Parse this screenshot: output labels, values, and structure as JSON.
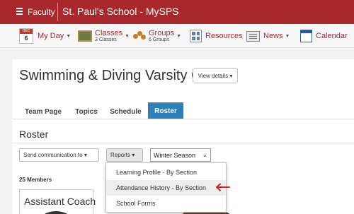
{
  "topbar": {
    "role": "Faculty",
    "school": "St. Paul's School - MySPS"
  },
  "nav": {
    "myday": {
      "label": "My Day",
      "cal_month": "DEC",
      "cal_day": "6"
    },
    "classes": {
      "label": "Classes",
      "count": "3 Classes"
    },
    "groups": {
      "label": "Groups",
      "count": "6 Groups"
    },
    "resources": {
      "label": "Resources"
    },
    "news": {
      "label": "News"
    },
    "calendar": {
      "label": "Calendar"
    }
  },
  "page": {
    "title": "Swimming & Diving Varsity Girls",
    "view_details": "View details ▾"
  },
  "tabs": [
    {
      "label": "Team Page"
    },
    {
      "label": "Topics"
    },
    {
      "label": "Schedule"
    },
    {
      "label": "Roster"
    }
  ],
  "roster": {
    "title": "Roster",
    "send_communication": "Send communication to ▾",
    "reports": "Reports ▾",
    "season": "Winter Season",
    "members": "25 Members",
    "card_title": "Assistant Coach"
  },
  "reports_menu": [
    {
      "label": "Learning Profile - By Section"
    },
    {
      "label": "Attendance History - By Section"
    },
    {
      "label": "School Forms"
    }
  ],
  "colors": {
    "brand": "#a8282c",
    "tab_active": "#2c7fb8"
  }
}
